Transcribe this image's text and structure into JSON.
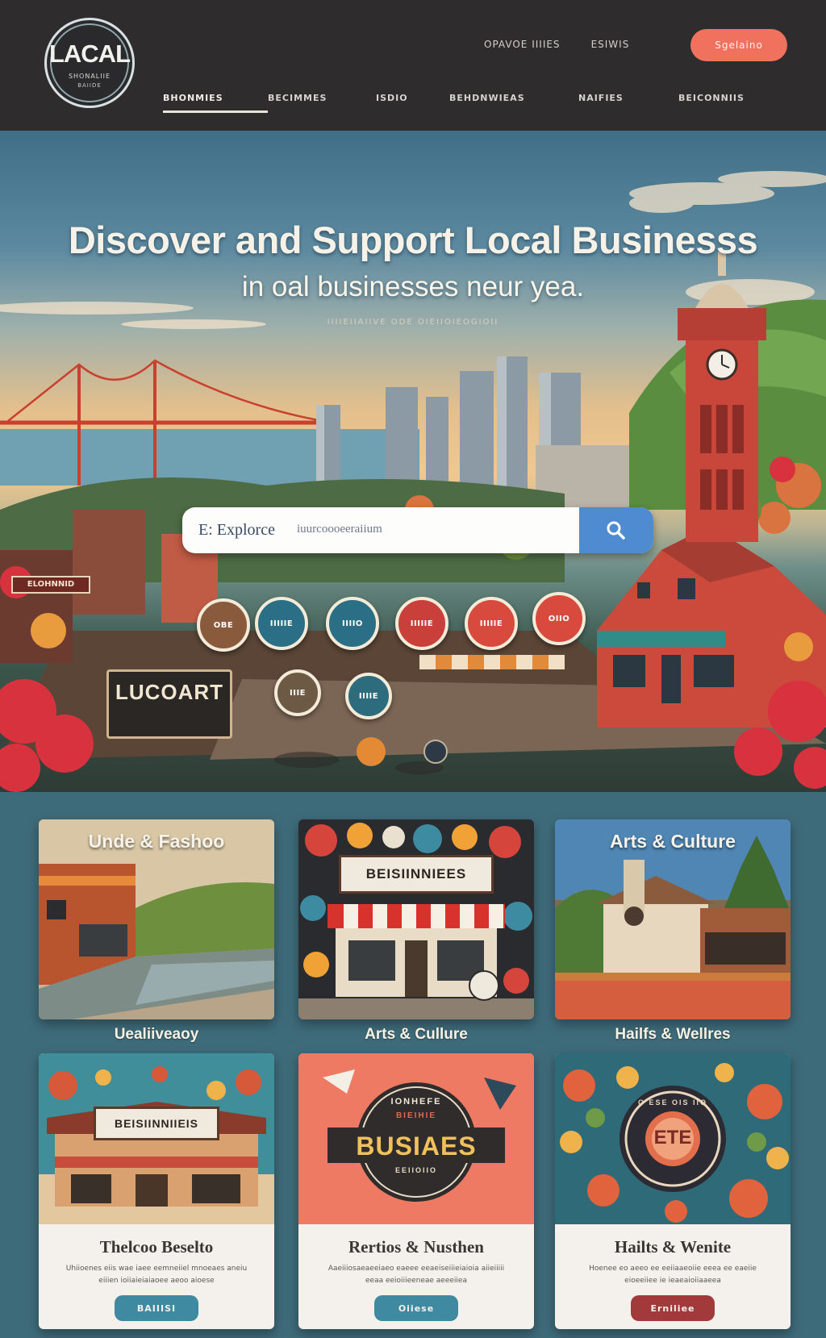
{
  "header": {
    "logo": {
      "title": "LACAL",
      "sub": "SHONALIIE",
      "sub2": "BAIIDE"
    },
    "top_links": [
      "OPAVOE IIIIES",
      "ESIWIS"
    ],
    "signup_label": "Sgelaino",
    "nav": [
      "BHONMIES",
      "BECIMMES",
      "ISDIO",
      "BEHDNWIEAS",
      "NAIFIES",
      "BEICONNIIS"
    ]
  },
  "hero": {
    "title": "Discover and Support Local Businesss",
    "subtitle": "in oal businesses neur yea.",
    "tagline": "IIIIEIIAIIVE ODE OIEIIOIEOGIOII",
    "search": {
      "value": "E: Explorce",
      "placeholder": "iuurcoooeeraiium"
    },
    "left_sign": "ELOHNNID",
    "shop_sign": "LUCOART",
    "badges": [
      "OBE",
      "IIIIIE",
      "IIIIO",
      "IIIIIE",
      "IIIIIE",
      "OIIO",
      "IIIE",
      "IIIIE"
    ]
  },
  "categories": [
    {
      "title": "Unde & Fashoo",
      "caption": "Uealiiveaoy"
    },
    {
      "title": "",
      "board": "BEISIINNIEES",
      "caption": "Arts & Cullure"
    },
    {
      "title": "Arts & Culture",
      "caption": "Hailfs & Wellres"
    }
  ],
  "cards": [
    {
      "board": "BEISIINNIIEIS",
      "title": "Thelcoo Beselto",
      "desc": "Uhiioenes eiis wae iaee eemneiiel mnoeaes aneiu eiiien ioiiaieiaiaoee aeoo aioese",
      "button": "BAIIISI",
      "button_color": "#3f8aa0"
    },
    {
      "emblem": "BUSIAES",
      "emblem_top": "IONHEFE",
      "emblem_mid": "BIEIHIE",
      "emblem_bottom": "EEIIOIIO",
      "title": "Rertios & Nusthen",
      "desc": "Aaeiiiosaeaeeiaeo eaeee eeaeiseiiieiaioia aiieiiiii eeaa eeioiiieeneae aeeeiiea",
      "button": "Oiiese",
      "button_color": "#3f8aa0"
    },
    {
      "emblem": "ETE",
      "emblem_ring": "O ESE OIS IIO",
      "title": "Hailts & Wenite",
      "desc": "Hoenee eo aeeo ee eeiiaaeoiie eeea ee eaeiie eioeeiiee ie ieaeaioiiaaeea",
      "button": "Erniliee",
      "button_color": "#a2393a"
    }
  ],
  "colors": {
    "header_bg": "#2e2c2d",
    "accent": "#f0715d",
    "search_button": "#4f8bd0",
    "page_bg": "#3e6b7a"
  }
}
